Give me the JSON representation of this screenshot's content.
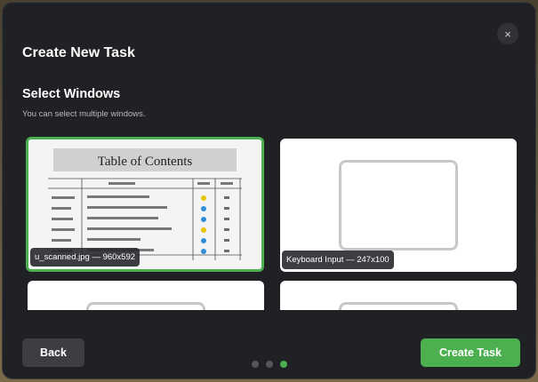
{
  "dialog": {
    "title": "Create New Task",
    "close_glyph": "×"
  },
  "section": {
    "title": "Select Windows",
    "subtitle": "You can select multiple windows."
  },
  "windows": [
    {
      "label": "u_scanned.jpg — 960x592",
      "selected": true,
      "thumbnail": "scanned-document"
    },
    {
      "label": "Keyboard Input — 247x100",
      "selected": false,
      "thumbnail": "placeholder-frame"
    },
    {
      "label": "",
      "selected": false,
      "thumbnail": "placeholder-frame"
    },
    {
      "label": "",
      "selected": false,
      "thumbnail": "placeholder-frame"
    }
  ],
  "scanned_doc": {
    "heading": "Table of Contents"
  },
  "footer": {
    "back_label": "Back",
    "create_label": "Create Task"
  },
  "pagination": {
    "total": 3,
    "current": 3
  },
  "colors": {
    "accent": "#4caf50",
    "modal_bg": "#202124",
    "back_button": "#3d3e42"
  }
}
